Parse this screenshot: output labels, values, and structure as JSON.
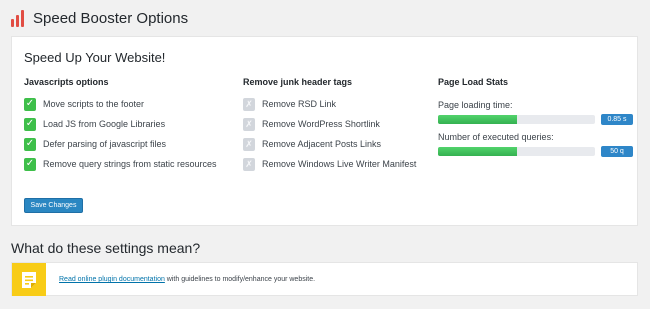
{
  "header": {
    "title": "Speed Booster Options",
    "icon": "bar-chart-icon",
    "brand_color": "#e14d43"
  },
  "panel": {
    "title": "Speed Up Your Website!",
    "js_options": {
      "heading": "Javascripts options",
      "items": [
        {
          "label": "Move scripts to the footer",
          "checked": true
        },
        {
          "label": "Load JS from Google Libraries",
          "checked": true
        },
        {
          "label": "Defer parsing of javascript files",
          "checked": true
        },
        {
          "label": "Remove query strings from static resources",
          "checked": true
        }
      ]
    },
    "junk_tags": {
      "heading": "Remove junk header tags",
      "items": [
        {
          "label": "Remove RSD Link",
          "checked": false
        },
        {
          "label": "Remove WordPress Shortlink",
          "checked": false
        },
        {
          "label": "Remove Adjacent Posts Links",
          "checked": false
        },
        {
          "label": "Remove Windows Live Writer Manifest",
          "checked": false
        }
      ]
    },
    "stats": {
      "heading": "Page Load Stats",
      "load_time": {
        "label": "Page loading time:",
        "value": "0.85 s",
        "fill_percent": 50
      },
      "queries": {
        "label": "Number of executed queries:",
        "value": "50 q",
        "fill_percent": 50
      }
    },
    "save_label": "Save Changes",
    "check_mark": "✓",
    "cross_mark": "✗"
  },
  "help": {
    "title": "What do these settings mean?",
    "link_text": "Read online plugin documentation",
    "text": " with guidelines to modify/enhance your website.",
    "icon": "document-icon"
  },
  "colors": {
    "accent": "#2a87c2",
    "check_on": "#3ebf4a",
    "check_off": "#d2d6dc",
    "progress": "#3dbf55",
    "badge": "#2e86c8",
    "help_icon_bg": "#f8cc17"
  }
}
